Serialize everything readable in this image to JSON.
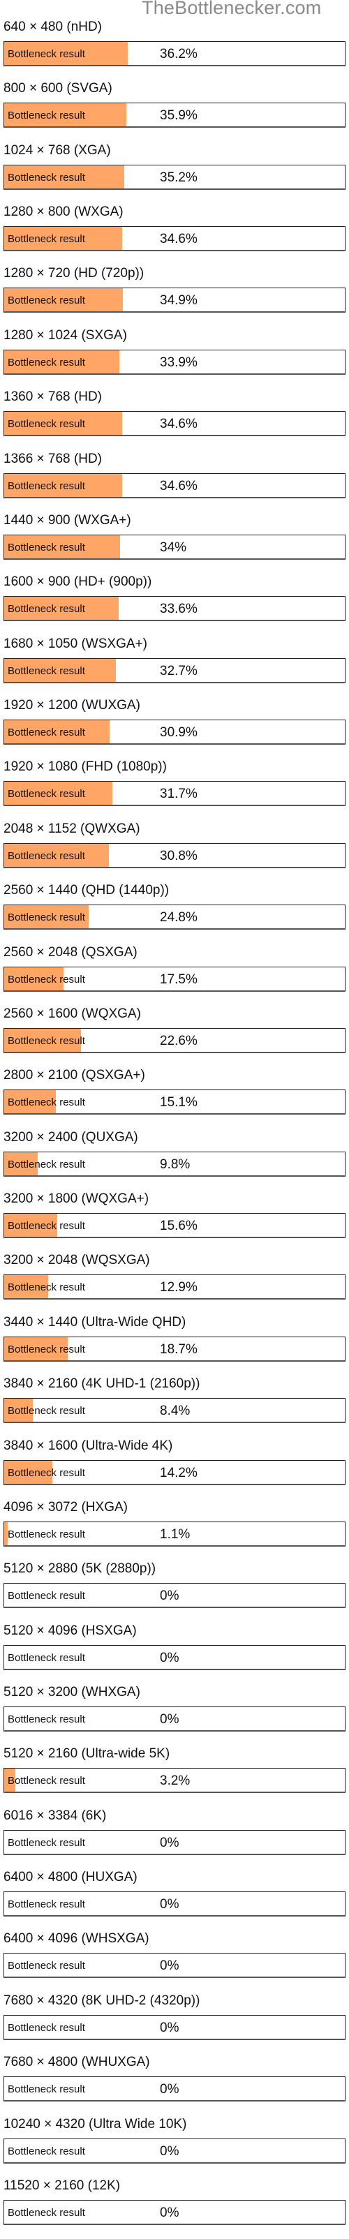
{
  "site": {
    "watermark": "TheBottlenecker.com"
  },
  "colors": {
    "fill": "#FFA566",
    "border": "#222222"
  },
  "bar_label": "Bottleneck result",
  "chart_data": {
    "type": "bar",
    "orientation": "horizontal",
    "title": "",
    "xlabel": "",
    "ylabel": "",
    "xlim": [
      0,
      100
    ],
    "series_label": "Bottleneck result",
    "categories": [
      "640 × 480 (nHD)",
      "800 × 600 (SVGA)",
      "1024 × 768 (XGA)",
      "1280 × 800 (WXGA)",
      "1280 × 720 (HD (720p))",
      "1280 × 1024 (SXGA)",
      "1360 × 768 (HD)",
      "1366 × 768 (HD)",
      "1440 × 900 (WXGA+)",
      "1600 × 900 (HD+ (900p))",
      "1680 × 1050 (WSXGA+)",
      "1920 × 1200 (WUXGA)",
      "1920 × 1080 (FHD (1080p))",
      "2048 × 1152 (QWXGA)",
      "2560 × 1440 (QHD (1440p))",
      "2560 × 2048 (QSXGA)",
      "2560 × 1600 (WQXGA)",
      "2800 × 2100 (QSXGA+)",
      "3200 × 2400 (QUXGA)",
      "3200 × 1800 (WQXGA+)",
      "3200 × 2048 (WQSXGA)",
      "3440 × 1440 (Ultra-Wide QHD)",
      "3840 × 2160 (4K UHD-1 (2160p))",
      "3840 × 1600 (Ultra-Wide 4K)",
      "4096 × 3072 (HXGA)",
      "5120 × 2880 (5K (2880p))",
      "5120 × 4096 (HSXGA)",
      "5120 × 3200 (WHXGA)",
      "5120 × 2160 (Ultra-wide 5K)",
      "6016 × 3384 (6K)",
      "6400 × 4800 (HUXGA)",
      "6400 × 4096 (WHSXGA)",
      "7680 × 4320 (8K UHD-2 (4320p))",
      "7680 × 4800 (WHUXGA)",
      "10240 × 4320 (Ultra Wide 10K)",
      "11520 × 2160 (12K)"
    ],
    "values": [
      36.2,
      35.9,
      35.2,
      34.6,
      34.9,
      33.9,
      34.6,
      34.6,
      34,
      33.6,
      32.7,
      30.9,
      31.7,
      30.8,
      24.8,
      17.5,
      22.6,
      15.1,
      9.8,
      15.6,
      12.9,
      18.7,
      8.4,
      14.2,
      1.1,
      0,
      0,
      0,
      3.2,
      0,
      0,
      0,
      0,
      0,
      0,
      0
    ],
    "value_labels": [
      "36.2%",
      "35.9%",
      "35.2%",
      "34.6%",
      "34.9%",
      "33.9%",
      "34.6%",
      "34.6%",
      "34%",
      "33.6%",
      "32.7%",
      "30.9%",
      "31.7%",
      "30.8%",
      "24.8%",
      "17.5%",
      "22.6%",
      "15.1%",
      "9.8%",
      "15.6%",
      "12.9%",
      "18.7%",
      "8.4%",
      "14.2%",
      "1.1%",
      "0%",
      "0%",
      "0%",
      "3.2%",
      "0%",
      "0%",
      "0%",
      "0%",
      "0%",
      "0%",
      "0%"
    ],
    "grid": false,
    "legend": "none"
  }
}
